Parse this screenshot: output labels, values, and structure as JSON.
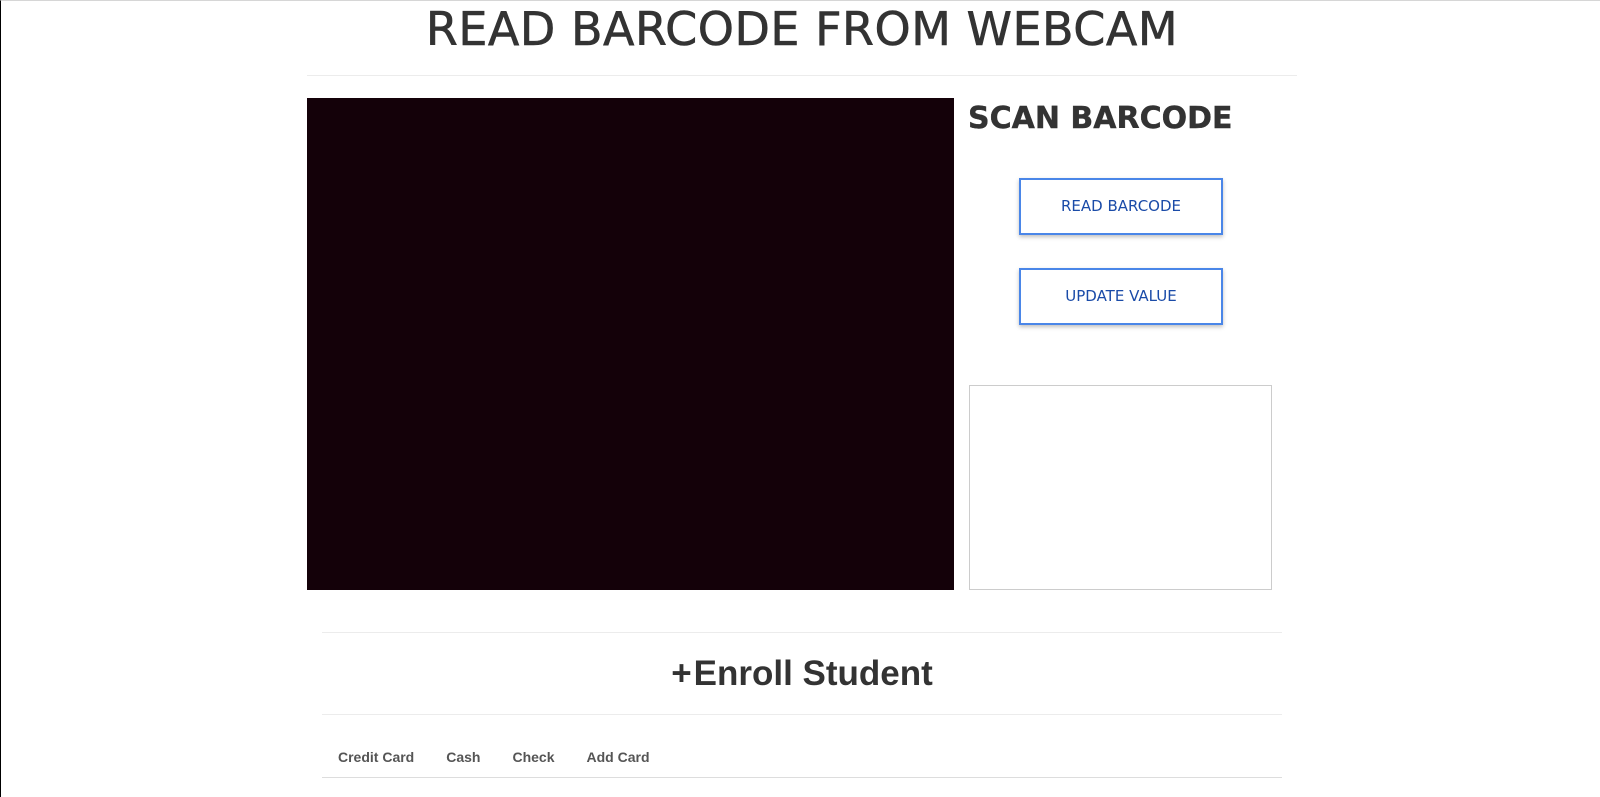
{
  "header": {
    "title": "READ BARCODE FROM WEBCAM"
  },
  "scanner": {
    "heading": "SCAN BARCODE",
    "read_button_label": "READ BARCODE",
    "update_button_label": "UPDATE VALUE",
    "result_text": ""
  },
  "enroll": {
    "plus_icon": "+",
    "heading": "Enroll Student"
  },
  "payment_tabs": [
    {
      "label": "Credit Card"
    },
    {
      "label": "Cash"
    },
    {
      "label": "Check"
    },
    {
      "label": "Add Card"
    }
  ],
  "colors": {
    "button_border": "#4a86e8",
    "button_text": "#1a4ba8",
    "webcam_background": "#140109",
    "heading_text": "#333333"
  }
}
